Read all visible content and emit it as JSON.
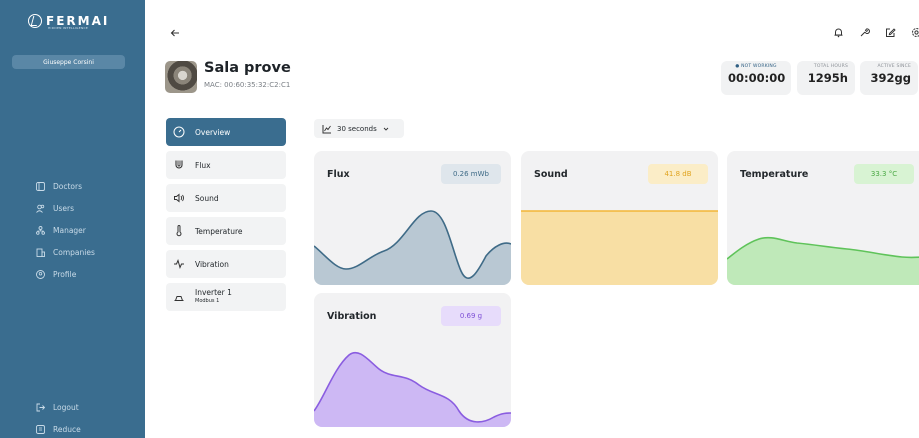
{
  "sidebar": {
    "logo_text": "FERMAI",
    "logo_sub": "HIDDEN INTELLIGENCE",
    "user_name": "Giuseppe Corsini",
    "nav": [
      {
        "label": "Doctors",
        "icon": "doctors-icon"
      },
      {
        "label": "Users",
        "icon": "users-icon"
      },
      {
        "label": "Manager",
        "icon": "manager-icon"
      },
      {
        "label": "Companies",
        "icon": "companies-icon"
      },
      {
        "label": "Profile",
        "icon": "profile-icon"
      }
    ],
    "bottom": [
      {
        "label": "Logout",
        "icon": "logout-icon"
      },
      {
        "label": "Reduce",
        "icon": "reduce-icon"
      }
    ],
    "color": "#3a6d8f"
  },
  "header": {
    "back_icon": "arrow-left-icon",
    "title": "Sala prove",
    "mac": "MAC: 00:60:35:32:C2:C1",
    "status_label": "● NOT WORKING",
    "status_value": "00:00:00",
    "total_hours_label": "TOTAL HOURS",
    "total_hours_value": "1295h",
    "active_since_label": "ACTIVE SINCE",
    "active_since_value": "392gg",
    "top_icons": [
      "bell-icon",
      "wrench-icon",
      "edit-icon",
      "settings-icon"
    ]
  },
  "menu": {
    "items": [
      {
        "label": "Overview",
        "icon": "gauge-icon",
        "active": true
      },
      {
        "label": "Flux",
        "icon": "magnet-icon"
      },
      {
        "label": "Sound",
        "icon": "speaker-icon"
      },
      {
        "label": "Temperature",
        "icon": "thermometer-icon"
      },
      {
        "label": "Vibration",
        "icon": "vibration-icon"
      },
      {
        "label": "Inverter 1",
        "sublabel": "Modbus 1",
        "icon": "inverter-icon"
      }
    ]
  },
  "interval": {
    "label": "30 seconds"
  },
  "cards": {
    "flux": {
      "title": "Flux",
      "value": "0.26 mWb",
      "color": "#3f6b87",
      "fill": "#b9c8d3",
      "badge_bg": "#dfe6ec",
      "badge_fg": "#3f6b87"
    },
    "sound": {
      "title": "Sound",
      "value": "41.8 dB",
      "color": "#f3b636",
      "fill": "#f8dfa4",
      "badge_bg": "#fbedc7",
      "badge_fg": "#e0a420"
    },
    "temperature": {
      "title": "Temperature",
      "value": "33.3 °C",
      "color": "#5fc35a",
      "fill": "#bfe9b9",
      "badge_bg": "#d8f3d3",
      "badge_fg": "#4aa844"
    },
    "vibration": {
      "title": "Vibration",
      "value": "0.69 g",
      "color": "#8a5de0",
      "fill": "#cdb8f4",
      "badge_bg": "#e7dcfb",
      "badge_fg": "#7e50d6"
    }
  }
}
